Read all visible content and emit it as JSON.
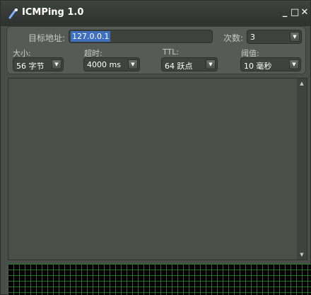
{
  "window": {
    "title": "ICMPing 1.0",
    "controls": {
      "minimize": "_",
      "maximize": "□",
      "close": "✕"
    }
  },
  "config": {
    "target": {
      "label": "目标地址:",
      "value": "127.0.0.1"
    },
    "count": {
      "label": "次数:",
      "value": "3"
    },
    "size": {
      "label": "大小:",
      "value": "56 字节"
    },
    "timeout": {
      "label": "超时:",
      "value": "4000 ms"
    },
    "ttl": {
      "label": "TTL:",
      "value": "64 跃点"
    },
    "threshold": {
      "label": "阈值:",
      "value": "10 毫秒"
    }
  },
  "icons": {
    "app": "ping-app-icon",
    "dropdown": "chevron-down-icon",
    "scroll_up": "scroll-up-icon",
    "scroll_down": "scroll-down-icon"
  },
  "colors": {
    "window_bg": "#4a4e48",
    "selection": "#3f6fbf",
    "graph_bg": "#000000",
    "graph_grid": "#1f7a2a"
  }
}
